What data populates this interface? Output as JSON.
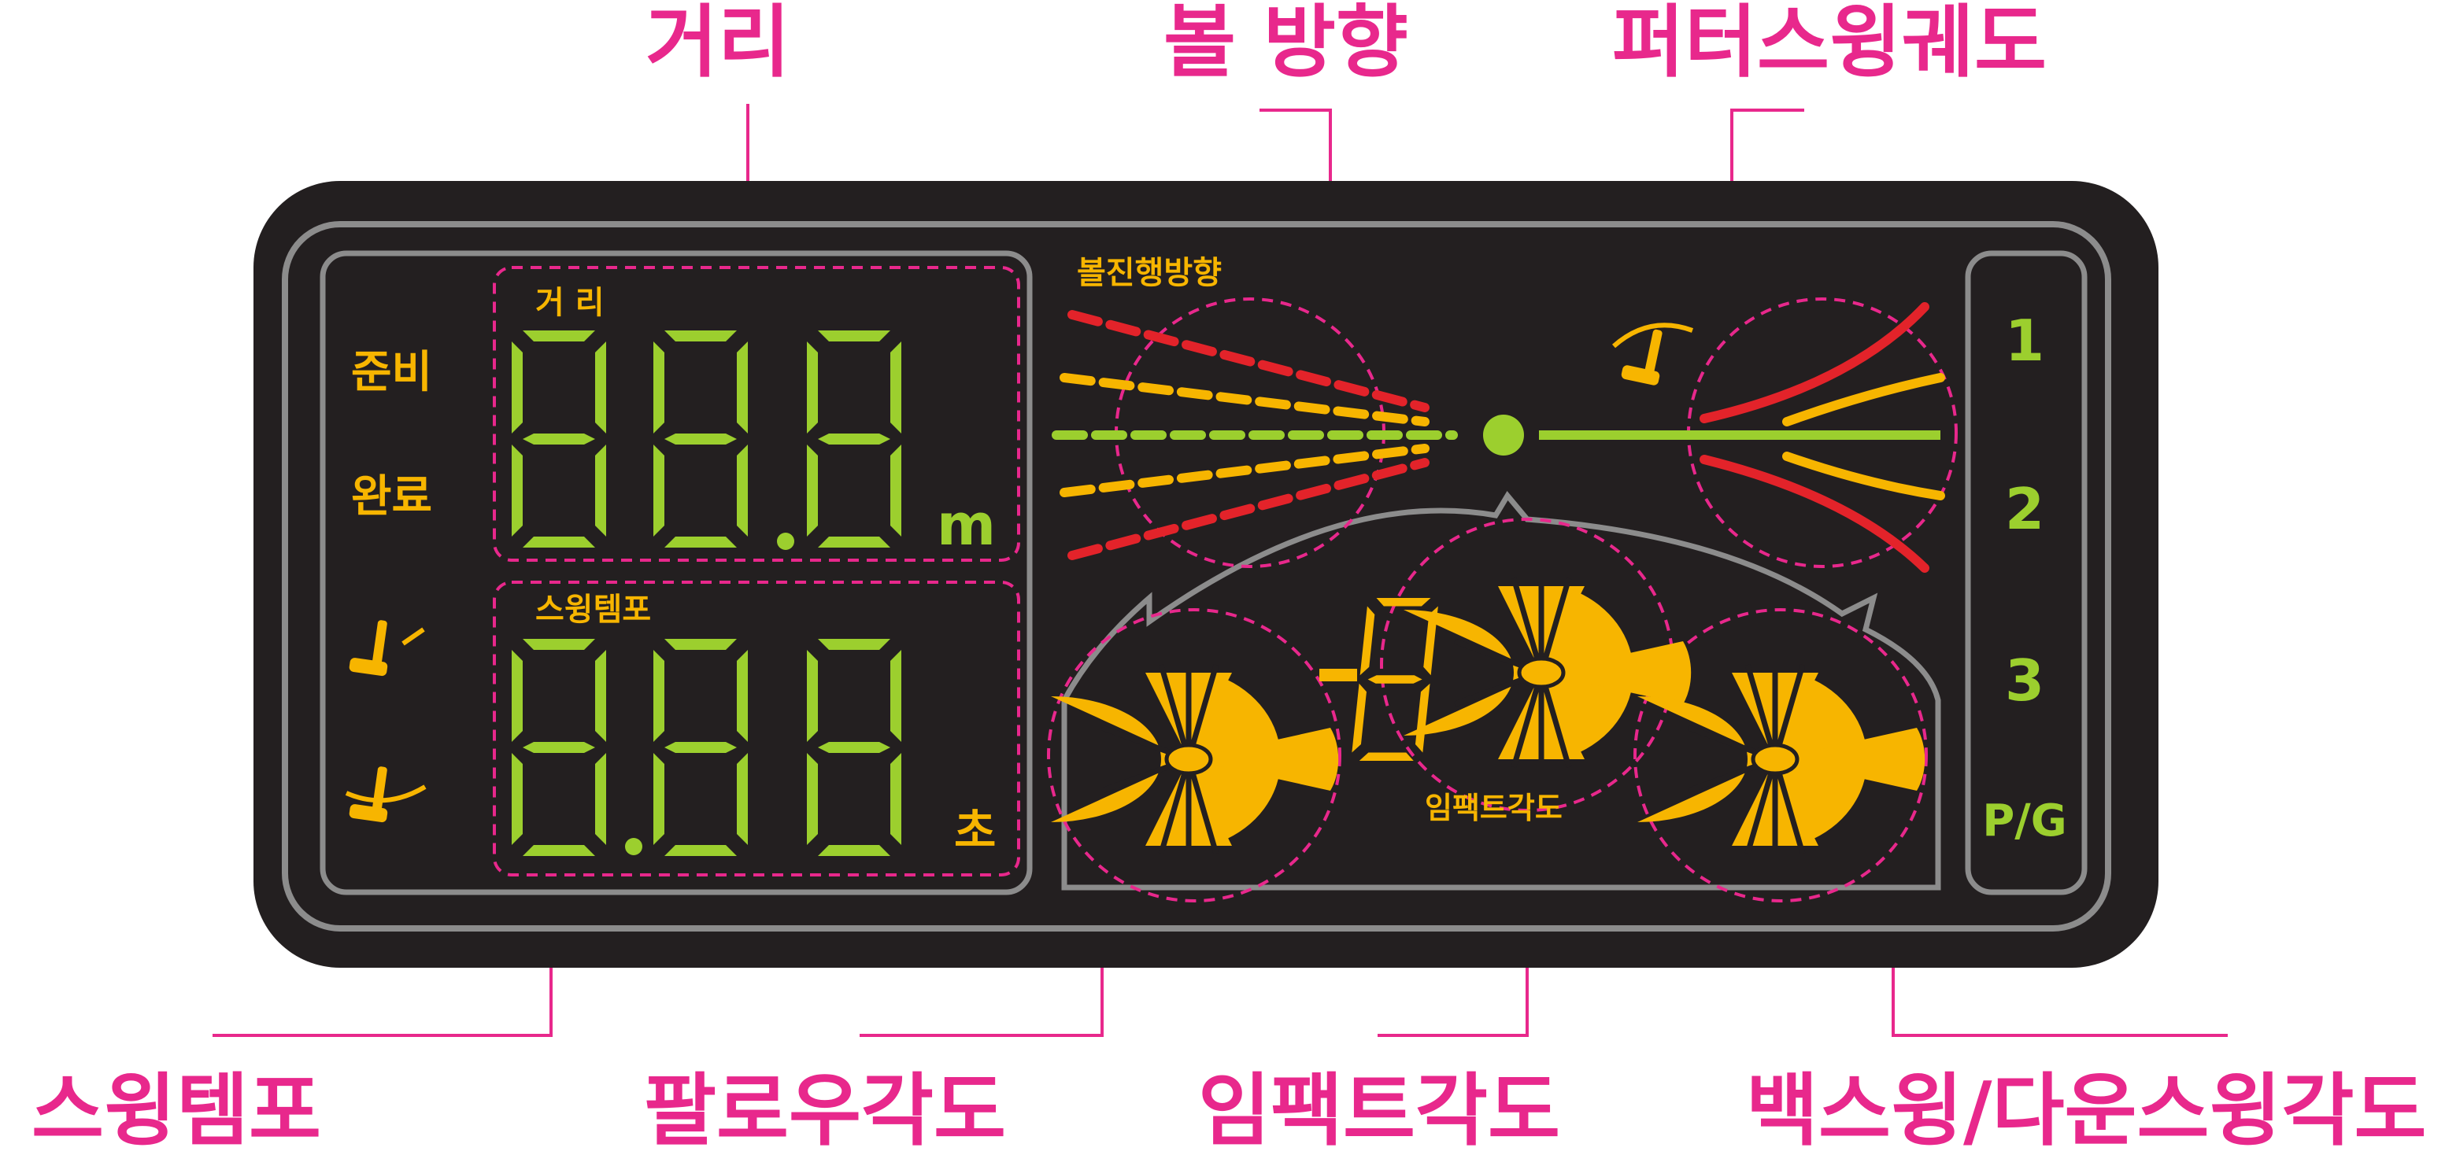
{
  "callouts": {
    "distance": "거리",
    "ball_direction": "볼 방향",
    "putter_swing_path": "퍼터스윙궤도",
    "swing_tempo": "스윙템포",
    "follow_angle": "팔로우각도",
    "impact_angle": "임팩트각도",
    "back_down_swing_angle": "백스윙/다운스윙각도"
  },
  "display": {
    "status_ready": "준비",
    "status_done": "완료",
    "distance_label": "거 리",
    "distance_value": "88.8",
    "distance_unit": "m",
    "tempo_label": "스윙템포",
    "tempo_value": "8.88",
    "tempo_unit": "초",
    "ball_direction_label": "볼진행방향",
    "impact_angle_label": "임팩트각도",
    "impact_digit": "-8",
    "modes": [
      "1",
      "2",
      "3",
      "P/G"
    ]
  },
  "colors": {
    "callout": "#e8288c",
    "panel": "#231f20",
    "frame": "#8c8c8c",
    "amber": "#f7b500",
    "lcd_green": "#9ccf2e",
    "red": "#e3232a"
  },
  "icons": [
    "putter-backswing-icon",
    "putter-downswing-icon",
    "putter-swing-icon",
    "fan-segment-icon"
  ]
}
